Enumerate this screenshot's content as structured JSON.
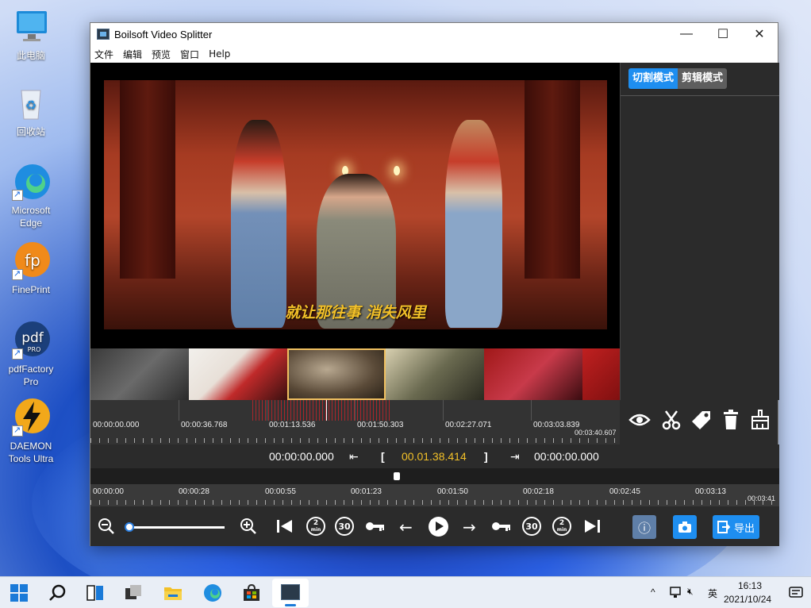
{
  "desktop": {
    "icons": [
      {
        "label": "此电脑"
      },
      {
        "label": "回收站"
      },
      {
        "label": "Microsoft Edge"
      },
      {
        "label": "FinePrint"
      },
      {
        "label": "pdfFactory Pro"
      },
      {
        "label": "DAEMON Tools Ultra"
      }
    ],
    "fineprint_glyph": "fp",
    "pdf_glyph": "pdf",
    "pdf_badge": "PRO"
  },
  "window": {
    "title": "Boilsoft Video Splitter",
    "controls": {
      "minimize": "—",
      "maximize": "☐",
      "close": "✕"
    },
    "menu": [
      "文件",
      "编辑",
      "预览",
      "窗口",
      "Help"
    ]
  },
  "video": {
    "subtitle": "就让那往事  消失风里"
  },
  "side_panel": {
    "tabs": [
      {
        "label": "切割模式",
        "active": true
      },
      {
        "label": "剪辑模式",
        "active": false
      }
    ]
  },
  "timeline": {
    "ruler1_labels": [
      "00:00:00.000",
      "00:00:36.768",
      "00:01:13.536",
      "00:01:50.303",
      "00:02:27.071",
      "00:03:03.839"
    ],
    "ruler1_end": "00:03:40.607",
    "ruler2_labels": [
      "00:00:00",
      "00:00:28",
      "00:00:55",
      "00:01:23",
      "00:01:50",
      "00:02:18",
      "00:02:45",
      "00:03:13"
    ],
    "ruler2_end": "00:03:41"
  },
  "timebar": {
    "start": "00:00:00.000",
    "bracket_left": "[",
    "current": "00.01.38.414",
    "bracket_right": "]",
    "end": "00:00:00.000"
  },
  "controls": {
    "rewind_2": "2",
    "rewind_2_unit": "min",
    "rewind_30": "30",
    "forward_30": "30",
    "forward_2": "2",
    "forward_2_unit": "min",
    "export_label": "导出",
    "zoom_level": 0.05
  },
  "taskbar": {
    "time": "16:13",
    "date": "2021/10/24",
    "ime": "英"
  }
}
